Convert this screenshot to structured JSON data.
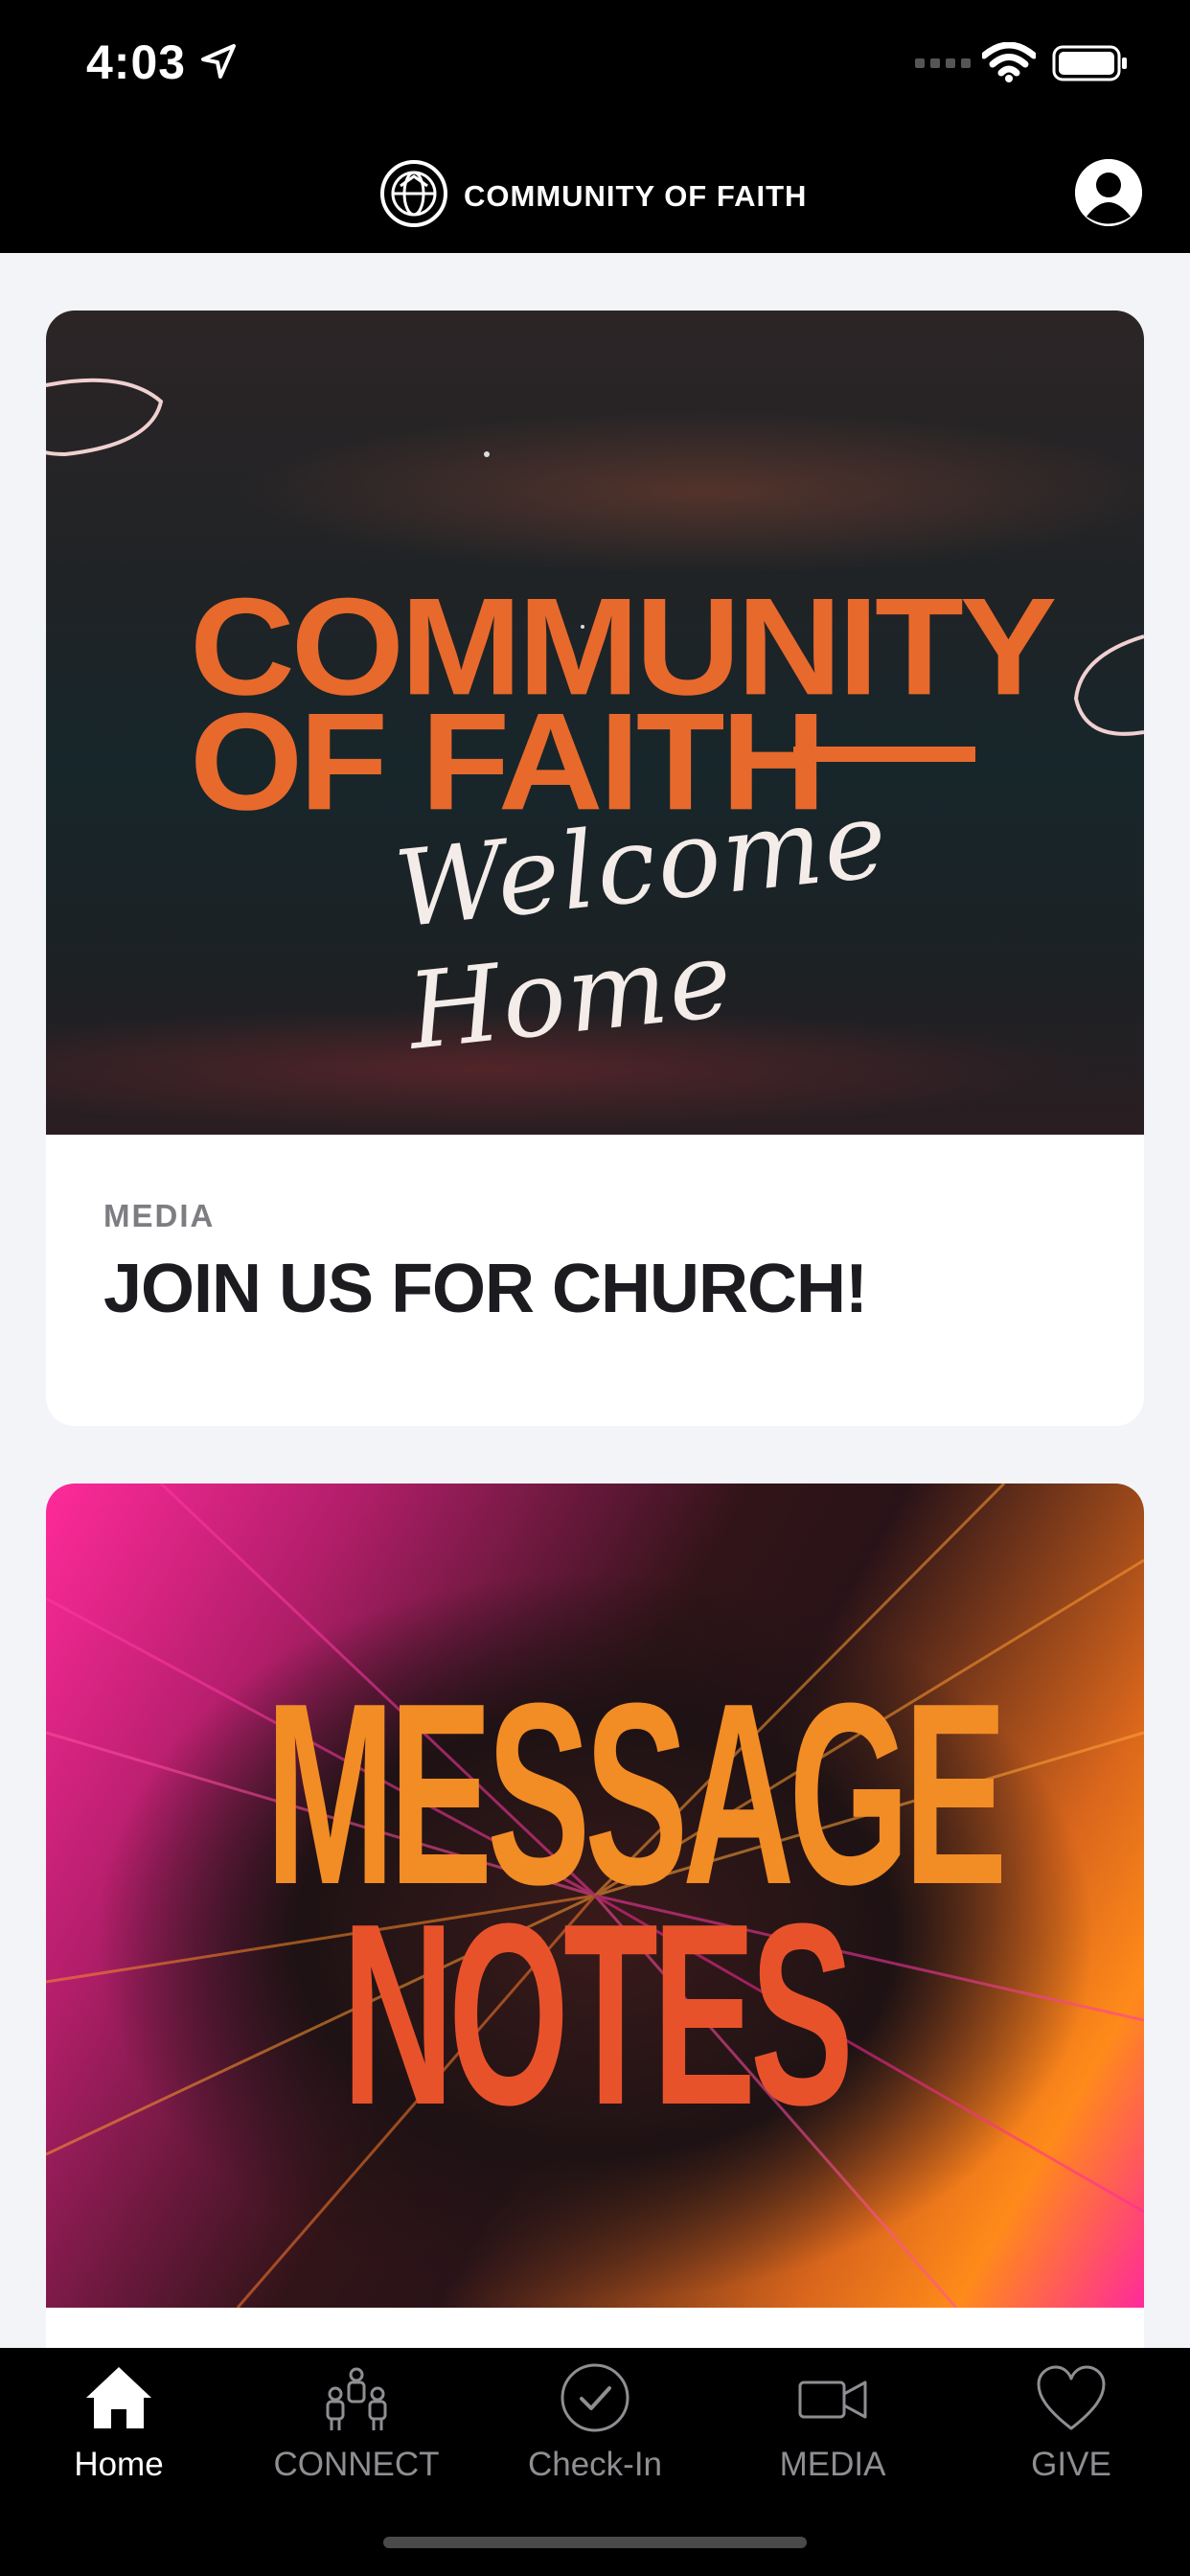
{
  "status_bar": {
    "time": "4:03"
  },
  "header": {
    "title": "COMMUNITY OF FAITH"
  },
  "feed": {
    "cards": [
      {
        "image": {
          "line1": "COMMUNITY",
          "line2": "OF FAITH",
          "script": "Welcome Home"
        },
        "category": "MEDIA",
        "title": "JOIN US FOR CHURCH!"
      },
      {
        "image": {
          "line1": "MESSAGE",
          "line2": "NOTES"
        }
      }
    ]
  },
  "tabs": [
    {
      "label": "Home",
      "icon": "home-icon",
      "active": true
    },
    {
      "label": "CONNECT",
      "icon": "people-icon",
      "active": false
    },
    {
      "label": "Check-In",
      "icon": "checkmark-circle-icon",
      "active": false
    },
    {
      "label": "MEDIA",
      "icon": "video-camera-icon",
      "active": false
    },
    {
      "label": "GIVE",
      "icon": "heart-icon",
      "active": false
    }
  ],
  "colors": {
    "accent_orange": "#e8692c",
    "background": "#f3f4f8",
    "bar_black": "#000000"
  }
}
